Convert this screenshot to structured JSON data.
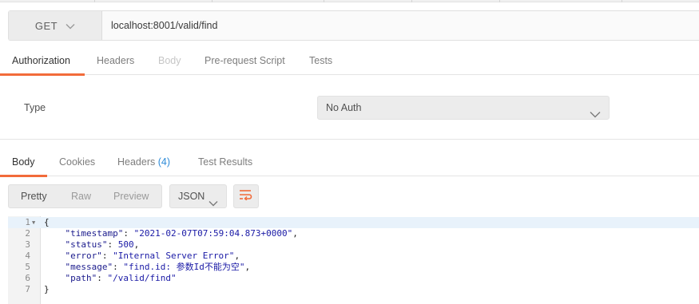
{
  "request": {
    "method": "GET",
    "url": "localhost:8001/valid/find"
  },
  "request_tabs": [
    {
      "label": "Authorization",
      "state": "active"
    },
    {
      "label": "Headers",
      "state": "normal"
    },
    {
      "label": "Body",
      "state": "disabled"
    },
    {
      "label": "Pre-request Script",
      "state": "normal"
    },
    {
      "label": "Tests",
      "state": "normal"
    }
  ],
  "auth": {
    "type_label": "Type",
    "selected": "No Auth"
  },
  "response_tabs": [
    {
      "label": "Body",
      "state": "active"
    },
    {
      "label": "Cookies",
      "state": "normal"
    },
    {
      "label": "Headers",
      "count": "(4)",
      "state": "normal"
    },
    {
      "label": "Test Results",
      "state": "normal"
    }
  ],
  "view_modes": [
    "Pretty",
    "Raw",
    "Preview"
  ],
  "format": "JSON",
  "code": {
    "line_numbers": [
      "1",
      "2",
      "3",
      "4",
      "5",
      "6",
      "7"
    ],
    "open_brace": "{",
    "close_brace": "}",
    "fields": [
      {
        "key": "\"timestamp\"",
        "value": "\"2021-02-07T07:59:04.873+0000\"",
        "sep": ","
      },
      {
        "key": "\"status\"",
        "value": "500",
        "sep": ","
      },
      {
        "key": "\"error\"",
        "value": "\"Internal Server Error\"",
        "sep": ","
      },
      {
        "key": "\"message\"",
        "value": "\"find.id: 参数Id不能为空\"",
        "sep": ","
      },
      {
        "key": "\"path\"",
        "value": "\"/valid/find\"",
        "sep": ""
      }
    ]
  },
  "colors": {
    "accent": "#f26b3a",
    "link": "#2e8bd8"
  },
  "icons": {
    "method_dropdown": "chevron-down-icon",
    "auth_dropdown": "chevron-down-icon",
    "format_dropdown": "chevron-down-icon",
    "wrap": "wrap-lines-icon",
    "fold": "fold-triangle-icon"
  }
}
